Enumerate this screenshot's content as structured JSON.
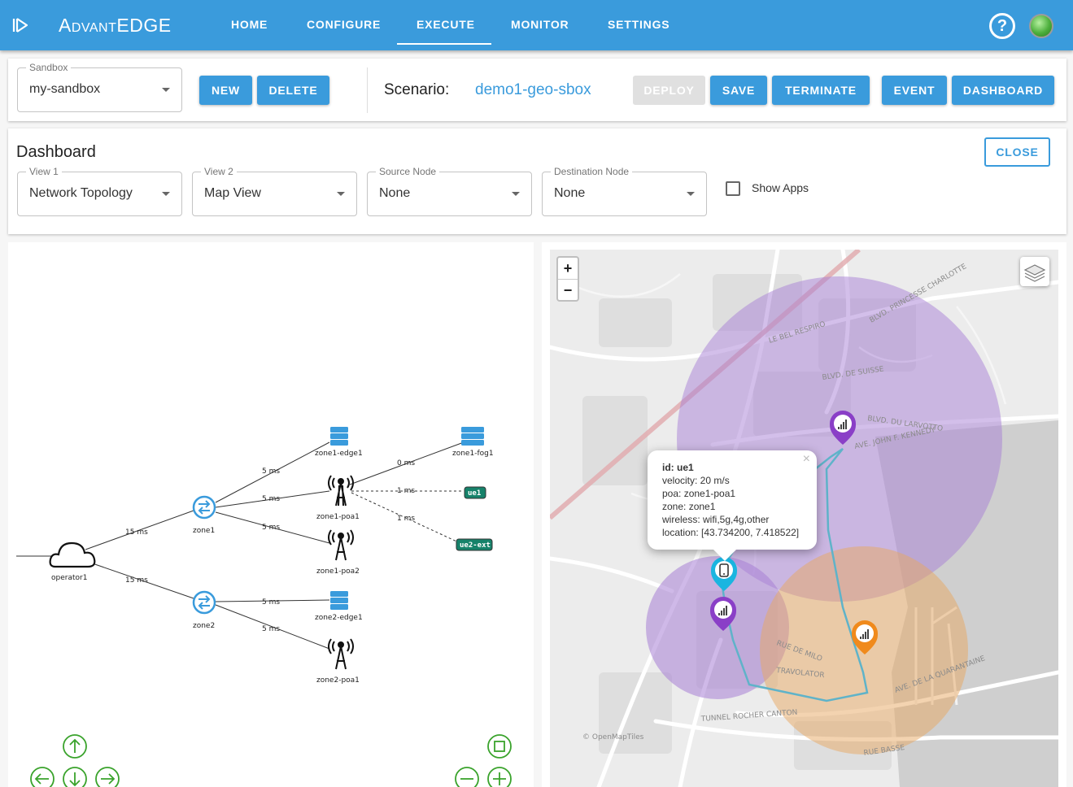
{
  "app": {
    "brand": "AdvantEDGE"
  },
  "nav": {
    "home": "HOME",
    "configure": "CONFIGURE",
    "execute": "EXECUTE",
    "monitor": "MONITOR",
    "settings": "SETTINGS",
    "help": "?"
  },
  "sandbox": {
    "label": "Sandbox",
    "value": "my-sandbox",
    "new_label": "NEW",
    "delete_label": "DELETE"
  },
  "scenario": {
    "label": "Scenario:",
    "name": "demo1-geo-sbox",
    "deploy_label": "DEPLOY",
    "save_label": "SAVE",
    "terminate_label": "TERMINATE",
    "event_label": "EVENT",
    "dashboard_label": "DASHBOARD"
  },
  "dashboard": {
    "title": "Dashboard",
    "close_label": "CLOSE",
    "view1": {
      "label": "View 1",
      "value": "Network Topology"
    },
    "view2": {
      "label": "View 2",
      "value": "Map View"
    },
    "source": {
      "label": "Source Node",
      "value": "None"
    },
    "destination": {
      "label": "Destination Node",
      "value": "None"
    },
    "show_apps_label": "Show Apps"
  },
  "topology": {
    "nodes": {
      "operator1": "operator1",
      "zone1": "zone1",
      "zone2": "zone2",
      "zone1_edge1": "zone1-edge1",
      "zone1_fog1": "zone1-fog1",
      "zone1_poa1": "zone1-poa1",
      "zone1_poa2": "zone1-poa2",
      "zone2_edge1": "zone2-edge1",
      "zone2_poa1": "zone2-poa1",
      "ue1": "ue1",
      "ue2_ext": "ue2-ext"
    },
    "latencies": {
      "op_zone1": "15 ms",
      "op_zone2": "15 ms",
      "z1_edge": "5 ms",
      "z1_poa1": "5 ms",
      "z1_poa2": "5 ms",
      "poa1_fog": "0 ms",
      "poa1_ue1": "1 ms",
      "poa1_ue2": "1 ms",
      "z2_edge": "5 ms",
      "z2_poa1": "5 ms"
    }
  },
  "map": {
    "zoom_in": "+",
    "zoom_out": "−",
    "streets": {
      "le_bel_respiro": "LE BEL RESPIRO",
      "blvd_princesse": "BLVD. PRINCESSE CHARLOTTE",
      "blvd_suisse": "BLVD. DE SUISSE",
      "blvd_larvotto": "BLVD. DU LARVOTTO",
      "ave_kennedy": "AVE. JOHN F. KENNEDY",
      "rue_milo": "RUE DE MILO",
      "travolator": "TRAVOLATOR",
      "ave_quarantaine": "AVE. DE LA QUARANTAINE",
      "tunnel_rocher": "TUNNEL ROCHER CANTON",
      "rue_basse": "RUE BASSE",
      "openmaptiles": "© OpenMapTiles"
    },
    "popup": {
      "id": "id: ue1",
      "velocity": "velocity: 20 m/s",
      "poa": "poa: zone1-poa1",
      "zone": "zone: zone1",
      "wireless": "wireless: wifi,5g,4g,other",
      "location": "location: [43.734200, 7.418522]",
      "close": "×"
    },
    "colors": {
      "poa_purple": "#8a3fc7",
      "poa_orange": "#f08a1c",
      "ue_cyan": "#1ab5e0",
      "route": "#5fb3c9"
    }
  }
}
